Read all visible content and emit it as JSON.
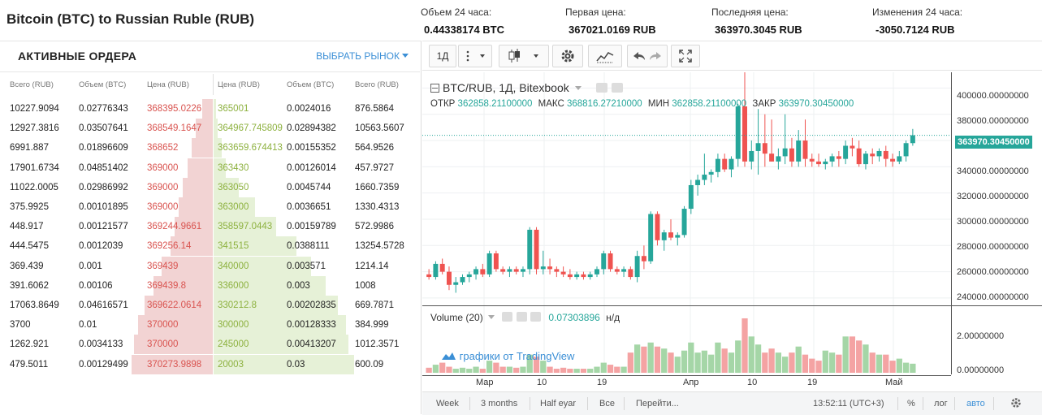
{
  "header": {
    "title": "Bitcoin (BTC) to Russian Ruble (RUB)",
    "stats": [
      {
        "label": "Объем 24 часа:",
        "value": "0.44338174 BTC"
      },
      {
        "label": "Первая цена:",
        "value": "367021.0169 RUB"
      },
      {
        "label": "Последняя цена:",
        "value": "363970.3045 RUB"
      },
      {
        "label": "Изменения 24 часа:",
        "value": "-3050.7124 RUB"
      }
    ]
  },
  "orders": {
    "title": "АКТИВНЫЕ ОРДЕРА",
    "market_link": "ВЫБРАТЬ РЫНОК",
    "columns": {
      "bid_total": "Всего (RUB)",
      "bid_volume": "Объем (BTC)",
      "bid_price": "Цена (RUB)",
      "ask_price": "Цена (RUB)",
      "ask_volume": "Объем (BTC)",
      "ask_total": "Всего (RUB)"
    },
    "bids": [
      {
        "total": "10227.9094",
        "volume": "0.02776343",
        "price": "368395.0226"
      },
      {
        "total": "12927.3816",
        "volume": "0.03507641",
        "price": "368549.1647"
      },
      {
        "total": "6991.887",
        "volume": "0.01896609",
        "price": "368652"
      },
      {
        "total": "17901.6734",
        "volume": "0.04851402",
        "price": "369000"
      },
      {
        "total": "11022.0005",
        "volume": "0.02986992",
        "price": "369000"
      },
      {
        "total": "375.9925",
        "volume": "0.00101895",
        "price": "369000"
      },
      {
        "total": "448.917",
        "volume": "0.00121577",
        "price": "369244.9661"
      },
      {
        "total": "444.5475",
        "volume": "0.0012039",
        "price": "369256.14"
      },
      {
        "total": "369.439",
        "volume": "0.001",
        "price": "369439"
      },
      {
        "total": "391.6062",
        "volume": "0.00106",
        "price": "369439.8"
      },
      {
        "total": "17063.8649",
        "volume": "0.04616571",
        "price": "369622.0614"
      },
      {
        "total": "3700",
        "volume": "0.01",
        "price": "370000"
      },
      {
        "total": "1262.921",
        "volume": "0.0034133",
        "price": "370000"
      },
      {
        "total": "479.5011",
        "volume": "0.00129499",
        "price": "370273.9898"
      }
    ],
    "asks": [
      {
        "price": "365001",
        "volume": "0.0024016",
        "total": "876.5864"
      },
      {
        "price": "364967.745809",
        "volume": "0.02894382",
        "total": "10563.5607"
      },
      {
        "price": "363659.674413",
        "volume": "0.00155352",
        "total": "564.9526"
      },
      {
        "price": "363430",
        "volume": "0.00126014",
        "total": "457.9727"
      },
      {
        "price": "363050",
        "volume": "0.0045744",
        "total": "1660.7359"
      },
      {
        "price": "363000",
        "volume": "0.0036651",
        "total": "1330.4313"
      },
      {
        "price": "358597.0443",
        "volume": "0.00159789",
        "total": "572.9986"
      },
      {
        "price": "341515",
        "volume": "0.0388111",
        "total": "13254.5728"
      },
      {
        "price": "340000",
        "volume": "0.003571",
        "total": "1214.14"
      },
      {
        "price": "336000",
        "volume": "0.003",
        "total": "1008"
      },
      {
        "price": "330212.8",
        "volume": "0.00202835",
        "total": "669.7871"
      },
      {
        "price": "300000",
        "volume": "0.00128333",
        "total": "384.999"
      },
      {
        "price": "245000",
        "volume": "0.00413207",
        "total": "1012.3571"
      },
      {
        "price": "20003",
        "volume": "0.03",
        "total": "600.09"
      }
    ],
    "bid_depth": [
      0.05,
      0.08,
      0.1,
      0.12,
      0.14,
      0.16,
      0.18,
      0.2,
      0.24,
      0.28,
      0.32,
      0.35,
      0.37,
      0.38
    ],
    "ask_depth": [
      0.01,
      0.02,
      0.04,
      0.06,
      0.12,
      0.2,
      0.3,
      0.4,
      0.47,
      0.54,
      0.6,
      0.64,
      0.65,
      0.68
    ]
  },
  "chart": {
    "toolbar": {
      "interval": "1Д"
    },
    "legend": {
      "symbol": "BTC/RUB, 1Д, Bitexbook"
    },
    "ohlc": [
      {
        "label": "ОТКР",
        "value": "362858.21100000"
      },
      {
        "label": "МАКС",
        "value": "368816.27210000"
      },
      {
        "label": "МИН",
        "value": "362858.21100000"
      },
      {
        "label": "ЗАКР",
        "value": "363970.30450000"
      }
    ],
    "last_price_tag": "363970.30450000",
    "volume_legend": {
      "label": "Volume (20)",
      "value": "0.07303896",
      "na": "н/д"
    },
    "brand": "графики от TradingView",
    "price_axis": [
      "400000.00000000",
      "380000.00000000",
      "360000.00000000",
      "340000.00000000",
      "320000.00000000",
      "300000.00000000",
      "280000.00000000",
      "260000.00000000",
      "240000.00000000"
    ],
    "volume_axis": [
      "2.00000000",
      "0.00000000"
    ],
    "time_axis": [
      "Мар",
      "10",
      "19",
      "Апр",
      "10",
      "19",
      "Май"
    ],
    "bottom": {
      "week": "Week",
      "three_months": "3 months",
      "half_year": "Half eyar",
      "all": "Все",
      "goto": "Перейти...",
      "time": "13:52:11 (UTC+3)",
      "percent": "%",
      "log": "лог",
      "auto": "авто"
    },
    "colors": {
      "up": "#26a69a",
      "down": "#ef5350",
      "vol_up": "#a5d6a7",
      "vol_down": "#f4a3a3",
      "accent": "#3b8fd6"
    }
  },
  "chart_data": {
    "type": "candlestick",
    "price_range": [
      235000,
      412000
    ],
    "volume_range": [
      0,
      2.9
    ],
    "candles": [
      [
        258000,
        262000,
        254000,
        256000,
        0.25
      ],
      [
        256000,
        268000,
        254000,
        266000,
        0.4
      ],
      [
        266000,
        270000,
        258000,
        260000,
        0.5
      ],
      [
        260000,
        264000,
        246000,
        250000,
        0.3
      ],
      [
        250000,
        256000,
        244000,
        252000,
        0.2
      ],
      [
        252000,
        258000,
        250000,
        256000,
        0.25
      ],
      [
        256000,
        260000,
        252000,
        258000,
        0.2
      ],
      [
        258000,
        264000,
        254000,
        262000,
        0.3
      ],
      [
        262000,
        266000,
        256000,
        258000,
        0.2
      ],
      [
        258000,
        276000,
        256000,
        274000,
        0.6
      ],
      [
        274000,
        276000,
        260000,
        262000,
        0.5
      ],
      [
        262000,
        264000,
        258000,
        260000,
        0.3
      ],
      [
        260000,
        264000,
        256000,
        262000,
        0.3
      ],
      [
        262000,
        264000,
        258000,
        260000,
        0.25
      ],
      [
        260000,
        264000,
        256000,
        262000,
        0.3
      ],
      [
        262000,
        294000,
        258000,
        292000,
        0.9
      ],
      [
        292000,
        294000,
        258000,
        262000,
        0.8
      ],
      [
        262000,
        276000,
        258000,
        264000,
        0.6
      ],
      [
        264000,
        270000,
        258000,
        262000,
        0.3
      ],
      [
        262000,
        264000,
        256000,
        260000,
        0.2
      ],
      [
        260000,
        264000,
        256000,
        258000,
        0.25
      ],
      [
        258000,
        262000,
        254000,
        256000,
        0.2
      ],
      [
        256000,
        260000,
        254000,
        258000,
        0.2
      ],
      [
        258000,
        260000,
        254000,
        256000,
        0.2
      ],
      [
        256000,
        260000,
        254000,
        258000,
        0.2
      ],
      [
        258000,
        264000,
        256000,
        262000,
        0.3
      ],
      [
        262000,
        276000,
        258000,
        274000,
        0.5
      ],
      [
        274000,
        276000,
        260000,
        262000,
        0.4
      ],
      [
        262000,
        264000,
        258000,
        260000,
        0.3
      ],
      [
        260000,
        264000,
        256000,
        262000,
        0.3
      ],
      [
        262000,
        264000,
        254000,
        256000,
        1.0
      ],
      [
        256000,
        276000,
        252000,
        272000,
        1.4
      ],
      [
        272000,
        280000,
        262000,
        268000,
        1.3
      ],
      [
        268000,
        306000,
        266000,
        304000,
        1.5
      ],
      [
        304000,
        306000,
        280000,
        284000,
        1.3
      ],
      [
        284000,
        292000,
        276000,
        290000,
        1.2
      ],
      [
        290000,
        300000,
        284000,
        286000,
        1.0
      ],
      [
        286000,
        290000,
        280000,
        288000,
        0.8
      ],
      [
        288000,
        310000,
        286000,
        308000,
        1.1
      ],
      [
        308000,
        330000,
        304000,
        326000,
        1.5
      ],
      [
        326000,
        334000,
        318000,
        330000,
        1.0
      ],
      [
        330000,
        350000,
        326000,
        334000,
        1.1
      ],
      [
        334000,
        338000,
        328000,
        336000,
        0.9
      ],
      [
        336000,
        350000,
        332000,
        346000,
        1.5
      ],
      [
        346000,
        350000,
        336000,
        338000,
        1.2
      ],
      [
        338000,
        348000,
        332000,
        346000,
        1.0
      ],
      [
        346000,
        388000,
        340000,
        386000,
        1.6
      ],
      [
        386000,
        412000,
        340000,
        344000,
        2.7
      ],
      [
        344000,
        360000,
        338000,
        352000,
        1.8
      ],
      [
        352000,
        384000,
        334000,
        358000,
        1.4
      ],
      [
        358000,
        380000,
        340000,
        350000,
        1.0
      ],
      [
        350000,
        376000,
        344000,
        344000,
        1.2
      ],
      [
        344000,
        354000,
        338000,
        348000,
        1.0
      ],
      [
        348000,
        380000,
        342000,
        354000,
        0.8
      ],
      [
        354000,
        362000,
        340000,
        344000,
        1.0
      ],
      [
        344000,
        368000,
        340000,
        360000,
        1.3
      ],
      [
        360000,
        376000,
        340000,
        346000,
        0.9
      ],
      [
        346000,
        350000,
        340000,
        344000,
        0.7
      ],
      [
        344000,
        350000,
        340000,
        342000,
        0.6
      ],
      [
        342000,
        346000,
        338000,
        344000,
        1.1
      ],
      [
        344000,
        350000,
        340000,
        348000,
        1.0
      ],
      [
        348000,
        352000,
        340000,
        346000,
        0.9
      ],
      [
        346000,
        360000,
        342000,
        356000,
        1.8
      ],
      [
        356000,
        362000,
        348000,
        354000,
        1.8
      ],
      [
        354000,
        360000,
        340000,
        342000,
        1.6
      ],
      [
        342000,
        352000,
        338000,
        350000,
        1.4
      ],
      [
        350000,
        354000,
        342000,
        348000,
        1.0
      ],
      [
        348000,
        354000,
        344000,
        352000,
        0.9
      ],
      [
        352000,
        356000,
        340000,
        346000,
        0.9
      ],
      [
        346000,
        350000,
        340000,
        344000,
        0.6
      ],
      [
        344000,
        352000,
        342000,
        348000,
        0.7
      ],
      [
        348000,
        360000,
        344000,
        358000,
        0.5
      ],
      [
        358000,
        368816,
        356000,
        363970,
        0.45
      ]
    ]
  }
}
